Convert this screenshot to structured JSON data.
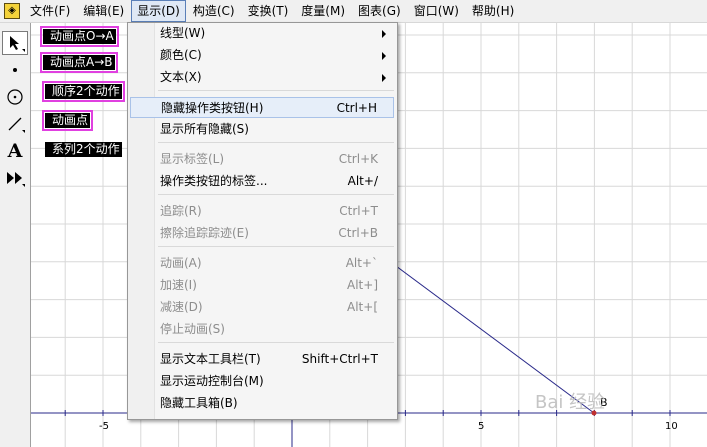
{
  "menubar": {
    "items": [
      {
        "label": "文件(F)"
      },
      {
        "label": "编辑(E)"
      },
      {
        "label": "显示(D)",
        "active": true
      },
      {
        "label": "构造(C)"
      },
      {
        "label": "变换(T)"
      },
      {
        "label": "度量(M)"
      },
      {
        "label": "图表(G)"
      },
      {
        "label": "窗口(W)"
      },
      {
        "label": "帮助(H)"
      }
    ]
  },
  "toolbox": {
    "tools": [
      "arrow-select-tool",
      "point-tool",
      "compass-tool",
      "straightedge-tool",
      "text-tool",
      "custom-tool"
    ],
    "text_tool_glyph": "A"
  },
  "buttons": [
    {
      "label": "动画点O→A",
      "selected": true
    },
    {
      "label": "动画点A→B",
      "selected": true
    },
    {
      "label": "顺序2个动作",
      "selected": true
    },
    {
      "label": "动画点",
      "selected": true
    },
    {
      "label": "系列2个动作",
      "selected": false
    }
  ],
  "dropdown": {
    "items": [
      {
        "label": "线型(W)",
        "shortcut": "",
        "submenu": true,
        "disabled": false,
        "highlighted": false
      },
      {
        "label": "颜色(C)",
        "shortcut": "",
        "submenu": true,
        "disabled": false,
        "highlighted": false
      },
      {
        "label": "文本(X)",
        "shortcut": "",
        "submenu": true,
        "disabled": false,
        "highlighted": false
      },
      {
        "label": "隐藏操作类按钮(H)",
        "shortcut": "Ctrl+H",
        "submenu": false,
        "disabled": false,
        "highlighted": true
      },
      {
        "label": "显示所有隐藏(S)",
        "shortcut": "",
        "submenu": false,
        "disabled": false,
        "highlighted": false
      },
      {
        "label": "显示标签(L)",
        "shortcut": "Ctrl+K",
        "submenu": false,
        "disabled": true,
        "highlighted": false
      },
      {
        "label": "操作类按钮的标签...",
        "shortcut": "Alt+/",
        "submenu": false,
        "disabled": false,
        "highlighted": false
      },
      {
        "label": "追踪(R)",
        "shortcut": "Ctrl+T",
        "submenu": false,
        "disabled": true,
        "highlighted": false
      },
      {
        "label": "擦除追踪踪迹(E)",
        "shortcut": "Ctrl+B",
        "submenu": false,
        "disabled": true,
        "highlighted": false
      },
      {
        "label": "动画(A)",
        "shortcut": "Alt+`",
        "submenu": false,
        "disabled": true,
        "highlighted": false
      },
      {
        "label": "加速(I)",
        "shortcut": "Alt+]",
        "submenu": false,
        "disabled": true,
        "highlighted": false
      },
      {
        "label": "减速(D)",
        "shortcut": "Alt+[",
        "submenu": false,
        "disabled": true,
        "highlighted": false
      },
      {
        "label": "停止动画(S)",
        "shortcut": "",
        "submenu": false,
        "disabled": true,
        "highlighted": false
      },
      {
        "label": "显示文本工具栏(T)",
        "shortcut": "Shift+Ctrl+T",
        "submenu": false,
        "disabled": false,
        "highlighted": false
      },
      {
        "label": "显示运动控制台(M)",
        "shortcut": "",
        "submenu": false,
        "disabled": false,
        "highlighted": false
      },
      {
        "label": "隐藏工具箱(B)",
        "shortcut": "",
        "submenu": false,
        "disabled": false,
        "highlighted": false
      }
    ]
  },
  "canvas": {
    "x_tick_labels": [
      "-5",
      "5",
      "10"
    ],
    "point_label": "B"
  },
  "watermark": "Bai 经验",
  "colors": {
    "button_outline": "#e040e0",
    "segment": "#2a2a8a",
    "grid": "#d8d8d8",
    "point": "#c03030"
  }
}
